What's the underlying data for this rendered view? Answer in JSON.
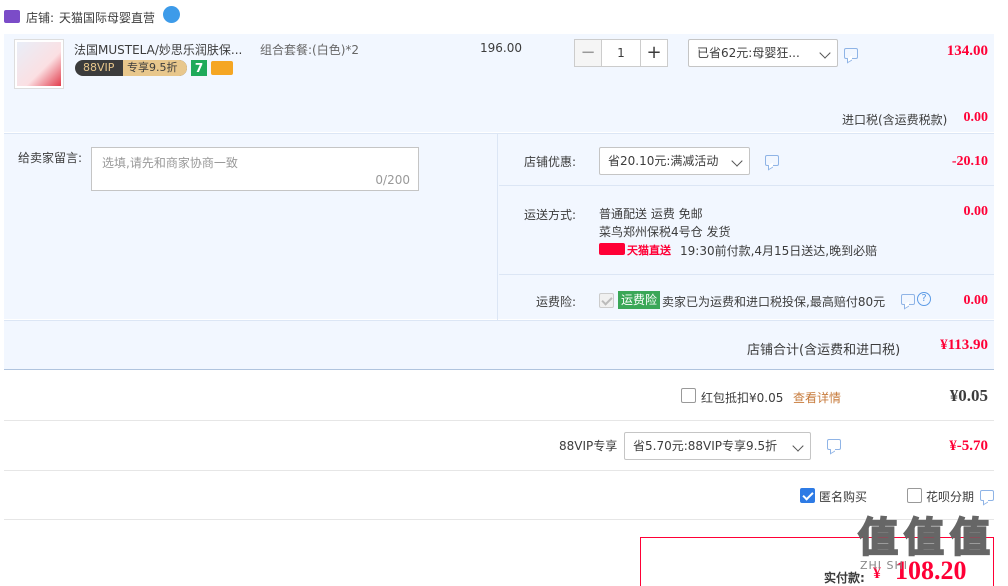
{
  "shop": {
    "label": "店铺:",
    "name": "天猫国际母婴直营"
  },
  "item": {
    "title": "法国MUSTELA/妙思乐润肤保...",
    "vip_badge": "88VIP",
    "vip_discount": "专享9.5折",
    "seven_badge": "7",
    "sku": "组合套餐:(白色)*2",
    "unit_price": "196.00",
    "quantity": "1",
    "promo_select": "已省62元:母婴狂...",
    "total": "134.00",
    "import_tax_label": "进口税(含运费税款)",
    "import_tax_value": "0.00"
  },
  "message": {
    "label": "给卖家留言:",
    "placeholder": "选填,请先和商家协商一致",
    "counter": "0/200"
  },
  "shop_discount": {
    "label": "店铺优惠:",
    "select": "省20.10元:满减活动",
    "value": "-20.10"
  },
  "shipping": {
    "label": "运送方式:",
    "line1": "普通配送 运费 免邮",
    "line2": "菜鸟郑州保税4号仓  发货",
    "tmall_direct": "天猫直送",
    "delivery_note": "19:30前付款,4月15日送达,晚到必赔",
    "value": "0.00"
  },
  "insurance": {
    "label": "运费险:",
    "tag": "运费险",
    "text": "卖家已为运费和进口税投保,最高赔付80元",
    "value": "0.00"
  },
  "shop_total": {
    "label": "店铺合计(含运费和进口税)",
    "value": "¥113.90"
  },
  "red_packet": {
    "label": "红包抵扣¥0.05",
    "link": "查看详情",
    "value": "¥0.05"
  },
  "vip": {
    "label": "88VIP专享",
    "select": "省5.70元:88VIP专享9.5折",
    "value": "¥-5.70"
  },
  "options": {
    "anonymous": "匿名购买",
    "huabei": "花呗分期"
  },
  "payment": {
    "label": "实付款:",
    "value": "108.20"
  },
  "watermark": {
    "text": "值 值 值",
    "site": "ZHI SHI"
  },
  "colors": {
    "accent": "#ff0036",
    "panel": "#f2f7ff",
    "link": "#2e7be5"
  }
}
